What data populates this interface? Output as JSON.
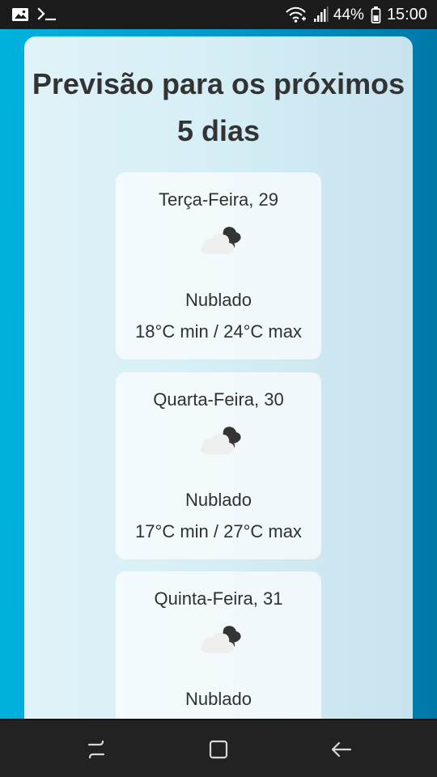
{
  "status_bar": {
    "battery_percent": "44%",
    "time": "15:00",
    "left_icons": [
      "gallery-icon",
      "terminal-icon"
    ],
    "right_icons": [
      "wifi-icon",
      "signal-icon",
      "battery-icon"
    ]
  },
  "forecast": {
    "title": "Previsão para os próximos 5 dias",
    "days": [
      {
        "date_label": "Terça-Feira, 29",
        "icon": "cloudy-icon",
        "condition": "Nublado",
        "temperature": "18°C min / 24°C max"
      },
      {
        "date_label": "Quarta-Feira, 30",
        "icon": "cloudy-icon",
        "condition": "Nublado",
        "temperature": "17°C min / 27°C max"
      },
      {
        "date_label": "Quinta-Feira, 31",
        "icon": "cloudy-icon",
        "condition": "Nublado",
        "temperature": ""
      }
    ]
  },
  "navigation": {
    "buttons": [
      "recent-apps-icon",
      "home-icon",
      "back-icon"
    ]
  },
  "colors": {
    "page_background": "#00A6D6",
    "panel_background": "#D8F0F7",
    "card_background": "#F3FAFD",
    "text": "#333333",
    "status_bar": "#1B1B1B",
    "navigation_bar": "#222222"
  }
}
